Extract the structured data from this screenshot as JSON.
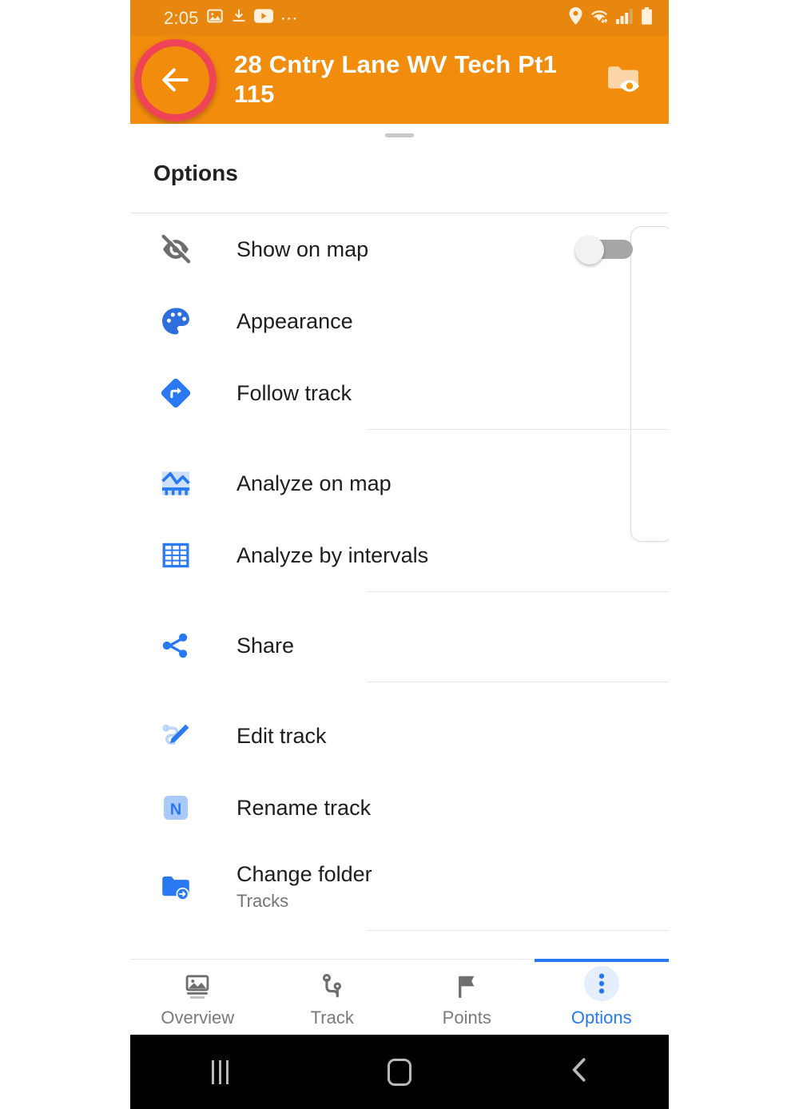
{
  "status_bar": {
    "time": "2:05",
    "left_icons": [
      "image-icon",
      "download-icon",
      "youtube-icon",
      "more-dots-icon"
    ],
    "right_icons": [
      "location-pin-icon",
      "wifi-icon",
      "signal-bars-icon",
      "battery-icon"
    ],
    "background_color": "#e8870f"
  },
  "app_bar": {
    "title": "28 Cntry Lane WV Tech Pt1 115",
    "back_icon": "back-arrow-icon",
    "action_icon": "folder-eye-icon",
    "background_color": "#f28c0d",
    "highlight_color": "#ef4455"
  },
  "sheet": {
    "title": "Options",
    "items": [
      {
        "label": "Show on map",
        "icon": "eye-off-icon",
        "icon_style": "gray",
        "control": "toggle",
        "toggle_on": false
      },
      {
        "label": "Appearance",
        "icon": "palette-icon",
        "icon_style": "blue"
      },
      {
        "label": "Follow track",
        "icon": "directions-diamond-icon",
        "icon_style": "blue"
      },
      {
        "label": "Analyze on map",
        "icon": "graph-chart-icon",
        "icon_style": "blue"
      },
      {
        "label": "Analyze by intervals",
        "icon": "grid-table-icon",
        "icon_style": "blue"
      },
      {
        "label": "Share",
        "icon": "share-nodes-icon",
        "icon_style": "blue"
      },
      {
        "label": "Edit track",
        "icon": "edit-pencil-track-icon",
        "icon_style": "blue"
      },
      {
        "label": "Rename track",
        "icon": "rename-n-icon",
        "icon_style": "blue"
      },
      {
        "label": "Change folder",
        "subtitle": "Tracks",
        "icon": "folder-move-icon",
        "icon_style": "blue"
      }
    ]
  },
  "bottom_nav": {
    "active": "Options",
    "accent_color": "#2979f4",
    "items": [
      {
        "label": "Overview",
        "icon": "image-overview-icon"
      },
      {
        "label": "Track",
        "icon": "route-track-icon"
      },
      {
        "label": "Points",
        "icon": "flag-points-icon"
      },
      {
        "label": "Options",
        "icon": "three-dots-vertical-icon"
      }
    ]
  },
  "system_nav": {
    "recents": "recents-icon",
    "home": "home-icon",
    "back": "back-icon"
  }
}
